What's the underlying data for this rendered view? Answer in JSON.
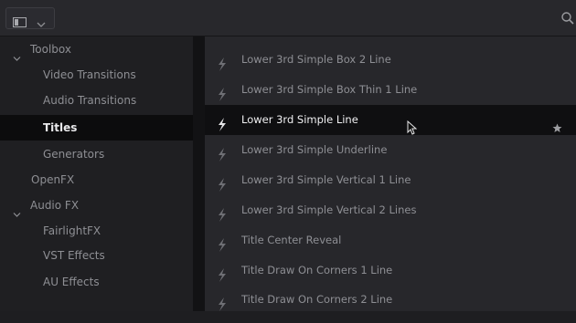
{
  "toolbar": {
    "view_toggle_icon": "panel-layout-icon",
    "view_toggle_chevron": "chevron-down-icon",
    "search_icon": "search-icon"
  },
  "sidebar": {
    "items": [
      {
        "label": "Toolbox",
        "type": "category",
        "expanded": true
      },
      {
        "label": "Video Transitions",
        "type": "sub"
      },
      {
        "label": "Audio Transitions",
        "type": "sub"
      },
      {
        "label": "Titles",
        "type": "sub",
        "selected": true
      },
      {
        "label": "Generators",
        "type": "sub"
      },
      {
        "label": "OpenFX",
        "type": "plain"
      },
      {
        "label": "Audio FX",
        "type": "category",
        "expanded": true
      },
      {
        "label": "FairlightFX",
        "type": "sub"
      },
      {
        "label": "VST Effects",
        "type": "sub"
      },
      {
        "label": "AU Effects",
        "type": "sub"
      }
    ]
  },
  "titles": {
    "items": [
      {
        "label": "Lower 3rd Simple Box 2 Line"
      },
      {
        "label": "Lower 3rd Simple Box Thin 1 Line"
      },
      {
        "label": "Lower 3rd Simple Line",
        "selected": true,
        "favorite_icon": "star-icon"
      },
      {
        "label": "Lower 3rd Simple Underline"
      },
      {
        "label": "Lower 3rd Simple Vertical 1 Line"
      },
      {
        "label": "Lower 3rd Simple Vertical 2 Lines"
      },
      {
        "label": "Title Center Reveal"
      },
      {
        "label": "Title Draw On Corners 1 Line"
      },
      {
        "label": "Title Draw On Corners 2 Line"
      }
    ],
    "item_icon": "lightning-bolt-icon"
  },
  "colors": {
    "background": "#1e1e21",
    "list_background": "#27272b",
    "selected_row": "#0f0f11",
    "text": "#8e8f94",
    "selected_text": "#f0f0f2"
  }
}
